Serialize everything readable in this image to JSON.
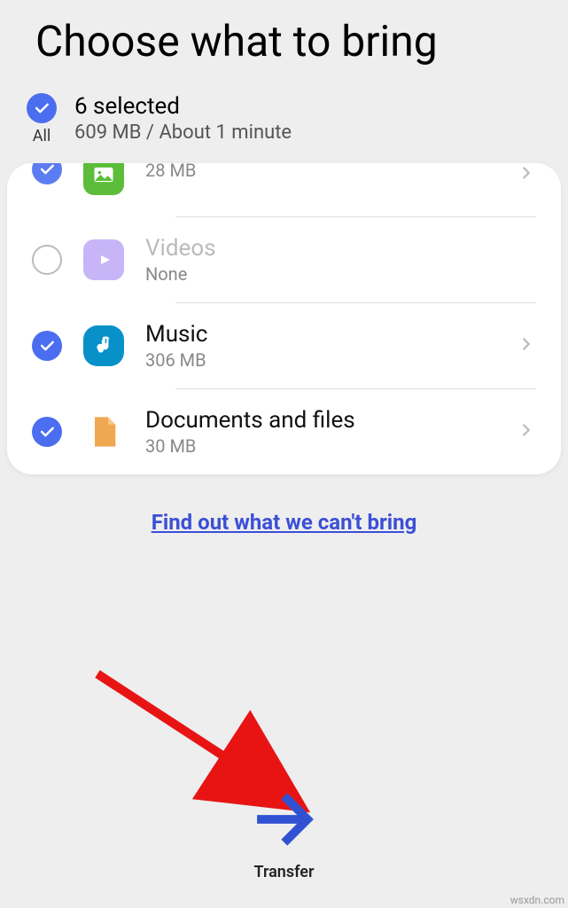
{
  "title": "Choose what to bring",
  "selectAll": {
    "label": "All",
    "checked": true
  },
  "summary": {
    "selected": "6 selected",
    "detail": "609 MB / About 1 minute"
  },
  "items": [
    {
      "title": "",
      "sub": "28 MB",
      "checked": true,
      "icon": "image",
      "disabled": false,
      "chevron": true
    },
    {
      "title": "Videos",
      "sub": "None",
      "checked": false,
      "icon": "video",
      "disabled": true,
      "chevron": false
    },
    {
      "title": "Music",
      "sub": "306 MB",
      "checked": true,
      "icon": "music",
      "disabled": false,
      "chevron": true
    },
    {
      "title": "Documents and files",
      "sub": "30 MB",
      "checked": true,
      "icon": "document",
      "disabled": false,
      "chevron": true
    }
  ],
  "link": "Find out what we can't bring",
  "transfer": "Transfer",
  "watermark": "wsxdn.com"
}
